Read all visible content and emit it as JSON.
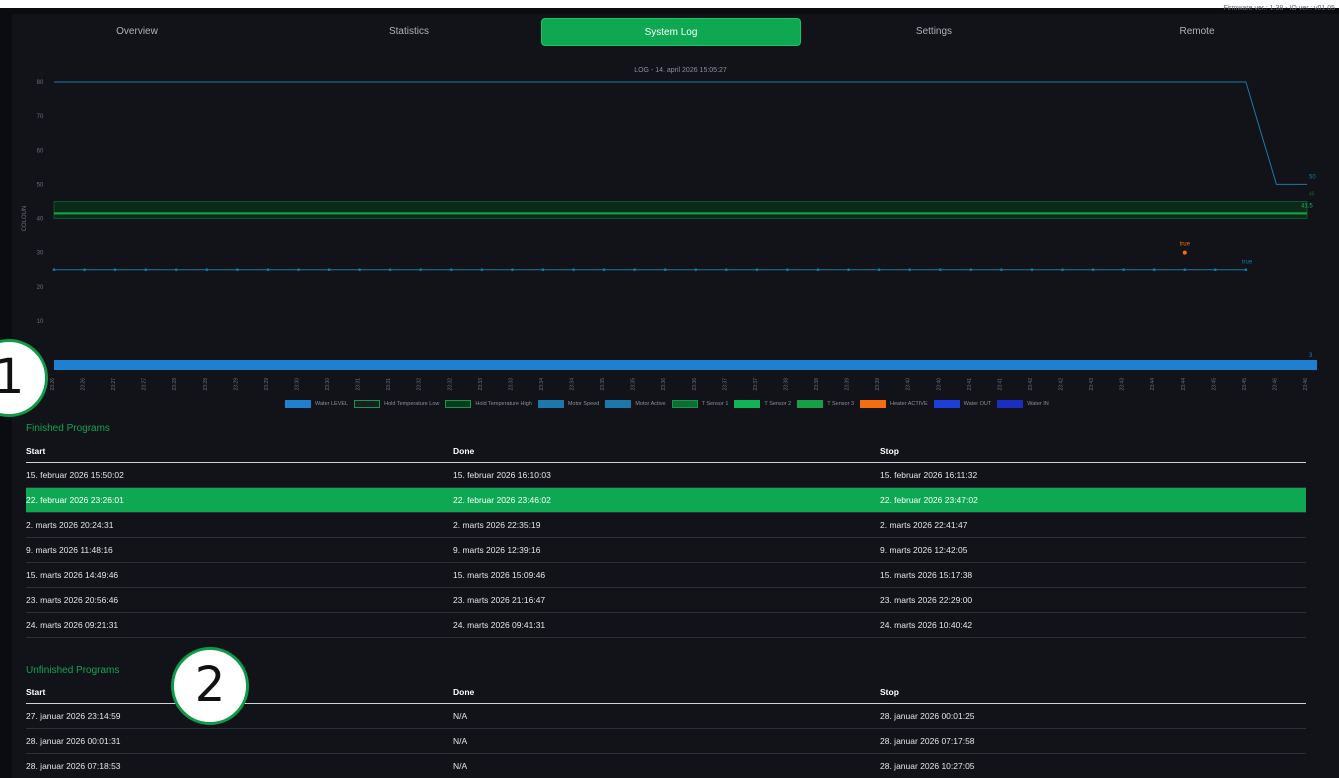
{
  "firmware": "Firmware ver.: 1.38 - IO ver.: v01.05",
  "tabs": [
    {
      "label": "Overview",
      "active": false
    },
    {
      "label": "Statistics",
      "active": false
    },
    {
      "label": "System Log",
      "active": true
    },
    {
      "label": "Settings",
      "active": false
    },
    {
      "label": "Remote",
      "active": false
    }
  ],
  "chart_data": {
    "type": "line",
    "title": "LOG - 14. april 2026 15:05:27",
    "ylabel": "COLOUN",
    "ylim": [
      0,
      80
    ],
    "yticks": [
      10,
      20,
      30,
      40,
      50,
      60,
      70,
      80
    ],
    "categories": [
      "23:26",
      "23:26",
      "23:27",
      "23:27",
      "23:28",
      "23:28",
      "23:29",
      "23:29",
      "23:30",
      "23:30",
      "23:31",
      "23:31",
      "23:32",
      "23:32",
      "23:33",
      "23:33",
      "23:34",
      "23:34",
      "23:35",
      "23:35",
      "23:36",
      "23:36",
      "23:37",
      "23:37",
      "23:38",
      "23:38",
      "23:39",
      "23:39",
      "23:40",
      "23:40",
      "23:41",
      "23:41",
      "23:42",
      "23:42",
      "23:43",
      "23:43",
      "23:44",
      "23:44",
      "23:45",
      "23:45",
      "23:46",
      "23:46"
    ],
    "series": [
      {
        "name": "Water LEVEL",
        "color": "#1f7fd0",
        "kind": "bar",
        "constant": 3
      },
      {
        "name": "Hold Temperature Low",
        "color": "#1a1d22",
        "constant": 45
      },
      {
        "name": "Hold Temperature High",
        "color": "#0b3b1e",
        "constant": 45
      },
      {
        "name": "Motor Speed",
        "color": "#1b78a8",
        "step_from": 80,
        "step_to": 50
      },
      {
        "name": "Motor Active",
        "color": "#1b78a8",
        "constant": 25
      },
      {
        "name": "T Sensor 1",
        "color": "#0f6b35",
        "constant": 41.5
      },
      {
        "name": "T Sensor 2",
        "color": "#10b454",
        "constant": 41.5
      },
      {
        "name": "T Sensor 3",
        "color": "#15a046",
        "constant": 41.5
      },
      {
        "name": "Heater ACTIVE",
        "color": "#f46d10"
      },
      {
        "name": "Water OUT",
        "color": "#1d3fd8"
      },
      {
        "name": "Water IN",
        "color": "#1a2fc0"
      }
    ],
    "annotations": [
      "50",
      "45",
      "41.5",
      "true",
      "true",
      "3"
    ]
  },
  "finished": {
    "title": "Finished Programs",
    "headers": [
      "Start",
      "Done",
      "Stop"
    ],
    "rows": [
      [
        "15. februar 2026 15:50:02",
        "15. februar 2026 16:10:03",
        "15. februar 2026 16:11:32"
      ],
      [
        "22. februar 2026 23:26:01",
        "22. februar 2026 23:46:02",
        "22. februar 2026 23:47:02"
      ],
      [
        "2. marts 2026 20:24:31",
        "2. marts 2026 22:35:19",
        "2. marts 2026 22:41:47"
      ],
      [
        "9. marts 2026 11:48:16",
        "9. marts 2026 12:39:16",
        "9. marts 2026 12:42:05"
      ],
      [
        "15. marts 2026 14:49:46",
        "15. marts 2026 15:09:46",
        "15. marts 2026 15:17:38"
      ],
      [
        "23. marts 2026 20:56:46",
        "23. marts 2026 21:16:47",
        "23. marts 2026 22:29:00"
      ],
      [
        "24. marts 2026 09:21:31",
        "24. marts 2026 09:41:31",
        "24. marts 2026 10:40:42"
      ]
    ],
    "selected_index": 1
  },
  "unfinished": {
    "title": "Unfinished Programs",
    "headers": [
      "Start",
      "Done",
      "Stop"
    ],
    "rows": [
      [
        "27. januar 2026 23:14:59",
        "N/A",
        "28. januar 2026 00:01:25"
      ],
      [
        "28. januar 2026 00:01:31",
        "N/A",
        "28. januar 2026 07:17:58"
      ],
      [
        "28. januar 2026 07:18:53",
        "N/A",
        "28. januar 2026 10:27:05"
      ]
    ]
  },
  "markers": [
    "1",
    "2"
  ]
}
